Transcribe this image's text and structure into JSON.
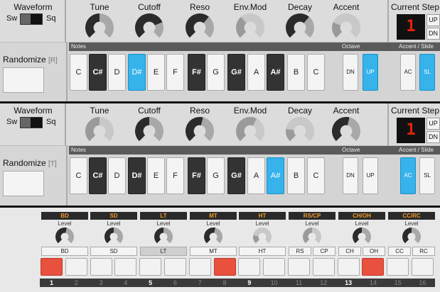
{
  "synths": [
    {
      "waveform": {
        "title": "Waveform",
        "left": "Sw",
        "right": "Sq",
        "selected": "Sq"
      },
      "knobs": [
        {
          "label": "Tune",
          "value": 0.5,
          "tone": "dark"
        },
        {
          "label": "Cutoff",
          "value": 0.75,
          "tone": "dark"
        },
        {
          "label": "Reso",
          "value": 0.65,
          "tone": "dark"
        },
        {
          "label": "Env.Mod",
          "value": 0.35,
          "tone": "light"
        },
        {
          "label": "Decay",
          "value": 0.65,
          "tone": "dark"
        },
        {
          "label": "Accent",
          "value": 0.25,
          "tone": "light"
        }
      ],
      "current_step": {
        "label": "Current Step",
        "value": "1",
        "up": "UP",
        "dn": "DN"
      },
      "bar": {
        "notes": "Notes",
        "octave": "Octave",
        "accent_slide": "Accent / Slide"
      },
      "randomize": {
        "label": "Randomize",
        "hotkey": "[R]"
      },
      "notes": [
        {
          "label": "C",
          "sharp": false,
          "on": false
        },
        {
          "label": "C#",
          "sharp": true,
          "on": false
        },
        {
          "label": "D",
          "sharp": false,
          "on": false
        },
        {
          "label": "D#",
          "sharp": true,
          "on": true
        },
        {
          "label": "E",
          "sharp": false,
          "on": false
        },
        {
          "label": "F",
          "sharp": false,
          "on": false
        },
        {
          "label": "F#",
          "sharp": true,
          "on": false
        },
        {
          "label": "G",
          "sharp": false,
          "on": false
        },
        {
          "label": "G#",
          "sharp": true,
          "on": false
        },
        {
          "label": "A",
          "sharp": false,
          "on": false
        },
        {
          "label": "A#",
          "sharp": true,
          "on": false
        },
        {
          "label": "B",
          "sharp": false,
          "on": false
        },
        {
          "label": "C",
          "sharp": false,
          "on": false
        }
      ],
      "octave": [
        {
          "label": "DN",
          "on": false
        },
        {
          "label": "UP",
          "on": true
        }
      ],
      "accent_slide": [
        {
          "label": "AC",
          "on": false
        },
        {
          "label": "SL",
          "on": true
        }
      ]
    },
    {
      "waveform": {
        "title": "Waveform",
        "left": "Sw",
        "right": "Sq",
        "selected": "Sq"
      },
      "knobs": [
        {
          "label": "Tune",
          "value": 0.5,
          "tone": "light"
        },
        {
          "label": "Cutoff",
          "value": 0.5,
          "tone": "dark"
        },
        {
          "label": "Reso",
          "value": 0.55,
          "tone": "dark"
        },
        {
          "label": "Env.Mod",
          "value": 0.6,
          "tone": "light"
        },
        {
          "label": "Decay",
          "value": 0.2,
          "tone": "light"
        },
        {
          "label": "Accent",
          "value": 0.55,
          "tone": "dark"
        }
      ],
      "current_step": {
        "label": "Current Step",
        "value": "1",
        "up": "UP",
        "dn": "DN"
      },
      "bar": {
        "notes": "Notes",
        "octave": "Octave",
        "accent_slide": "Accent / Slide"
      },
      "randomize": {
        "label": "Randomize",
        "hotkey": "[T]"
      },
      "notes": [
        {
          "label": "C",
          "sharp": false,
          "on": false
        },
        {
          "label": "C#",
          "sharp": true,
          "on": false
        },
        {
          "label": "D",
          "sharp": false,
          "on": false
        },
        {
          "label": "D#",
          "sharp": true,
          "on": false
        },
        {
          "label": "E",
          "sharp": false,
          "on": false
        },
        {
          "label": "F",
          "sharp": false,
          "on": false
        },
        {
          "label": "F#",
          "sharp": true,
          "on": false
        },
        {
          "label": "G",
          "sharp": false,
          "on": false
        },
        {
          "label": "G#",
          "sharp": true,
          "on": false
        },
        {
          "label": "A",
          "sharp": false,
          "on": false
        },
        {
          "label": "A#",
          "sharp": true,
          "on": true
        },
        {
          "label": "B",
          "sharp": false,
          "on": false
        },
        {
          "label": "C",
          "sharp": false,
          "on": false
        }
      ],
      "octave": [
        {
          "label": "DN",
          "on": false
        },
        {
          "label": "UP",
          "on": false
        }
      ],
      "accent_slide": [
        {
          "label": "AC",
          "on": true
        },
        {
          "label": "SL",
          "on": false
        }
      ]
    }
  ],
  "drums": {
    "level_label": "Level",
    "instruments": [
      {
        "name": "BD",
        "level": 0.55,
        "tone": "dark",
        "buttons": [
          {
            "label": "BD",
            "on": false
          }
        ]
      },
      {
        "name": "SD",
        "level": 0.5,
        "tone": "dark",
        "buttons": [
          {
            "label": "SD",
            "on": false
          }
        ]
      },
      {
        "name": "LT",
        "level": 0.5,
        "tone": "dark",
        "buttons": [
          {
            "label": "LT",
            "on": true
          }
        ]
      },
      {
        "name": "MT",
        "level": 0.55,
        "tone": "dark",
        "buttons": [
          {
            "label": "MT",
            "on": false
          }
        ]
      },
      {
        "name": "HT",
        "level": 0.2,
        "tone": "light",
        "buttons": [
          {
            "label": "HT",
            "on": false
          }
        ]
      },
      {
        "name": "RS/CP",
        "level": 0.5,
        "tone": "light",
        "buttons": [
          {
            "label": "RS",
            "on": false
          },
          {
            "label": "CP",
            "on": false
          }
        ]
      },
      {
        "name": "CH/OH",
        "level": 0.5,
        "tone": "dark",
        "buttons": [
          {
            "label": "CH",
            "on": false
          },
          {
            "label": "OH",
            "on": false
          }
        ]
      },
      {
        "name": "CC/RC",
        "level": 0.5,
        "tone": "dark",
        "buttons": [
          {
            "label": "CC",
            "on": false
          },
          {
            "label": "RC",
            "on": false
          }
        ]
      }
    ],
    "steps": [
      {
        "n": "1",
        "on": true,
        "bold": true
      },
      {
        "n": "2",
        "on": false,
        "bold": false
      },
      {
        "n": "3",
        "on": false,
        "bold": false
      },
      {
        "n": "4",
        "on": false,
        "bold": false
      },
      {
        "n": "5",
        "on": false,
        "bold": true
      },
      {
        "n": "6",
        "on": false,
        "bold": false
      },
      {
        "n": "7",
        "on": false,
        "bold": false
      },
      {
        "n": "8",
        "on": true,
        "bold": false
      },
      {
        "n": "9",
        "on": false,
        "bold": true
      },
      {
        "n": "10",
        "on": false,
        "bold": false
      },
      {
        "n": "11",
        "on": false,
        "bold": false
      },
      {
        "n": "12",
        "on": false,
        "bold": false
      },
      {
        "n": "13",
        "on": false,
        "bold": true
      },
      {
        "n": "14",
        "on": true,
        "bold": false
      },
      {
        "n": "15",
        "on": false,
        "bold": false
      },
      {
        "n": "16",
        "on": false,
        "bold": false
      }
    ]
  },
  "colors": {
    "accent_blue": "#35b3ea",
    "step_on": "#e8513e",
    "display_red": "#e8200a",
    "drum_label": "#f29b2c"
  }
}
